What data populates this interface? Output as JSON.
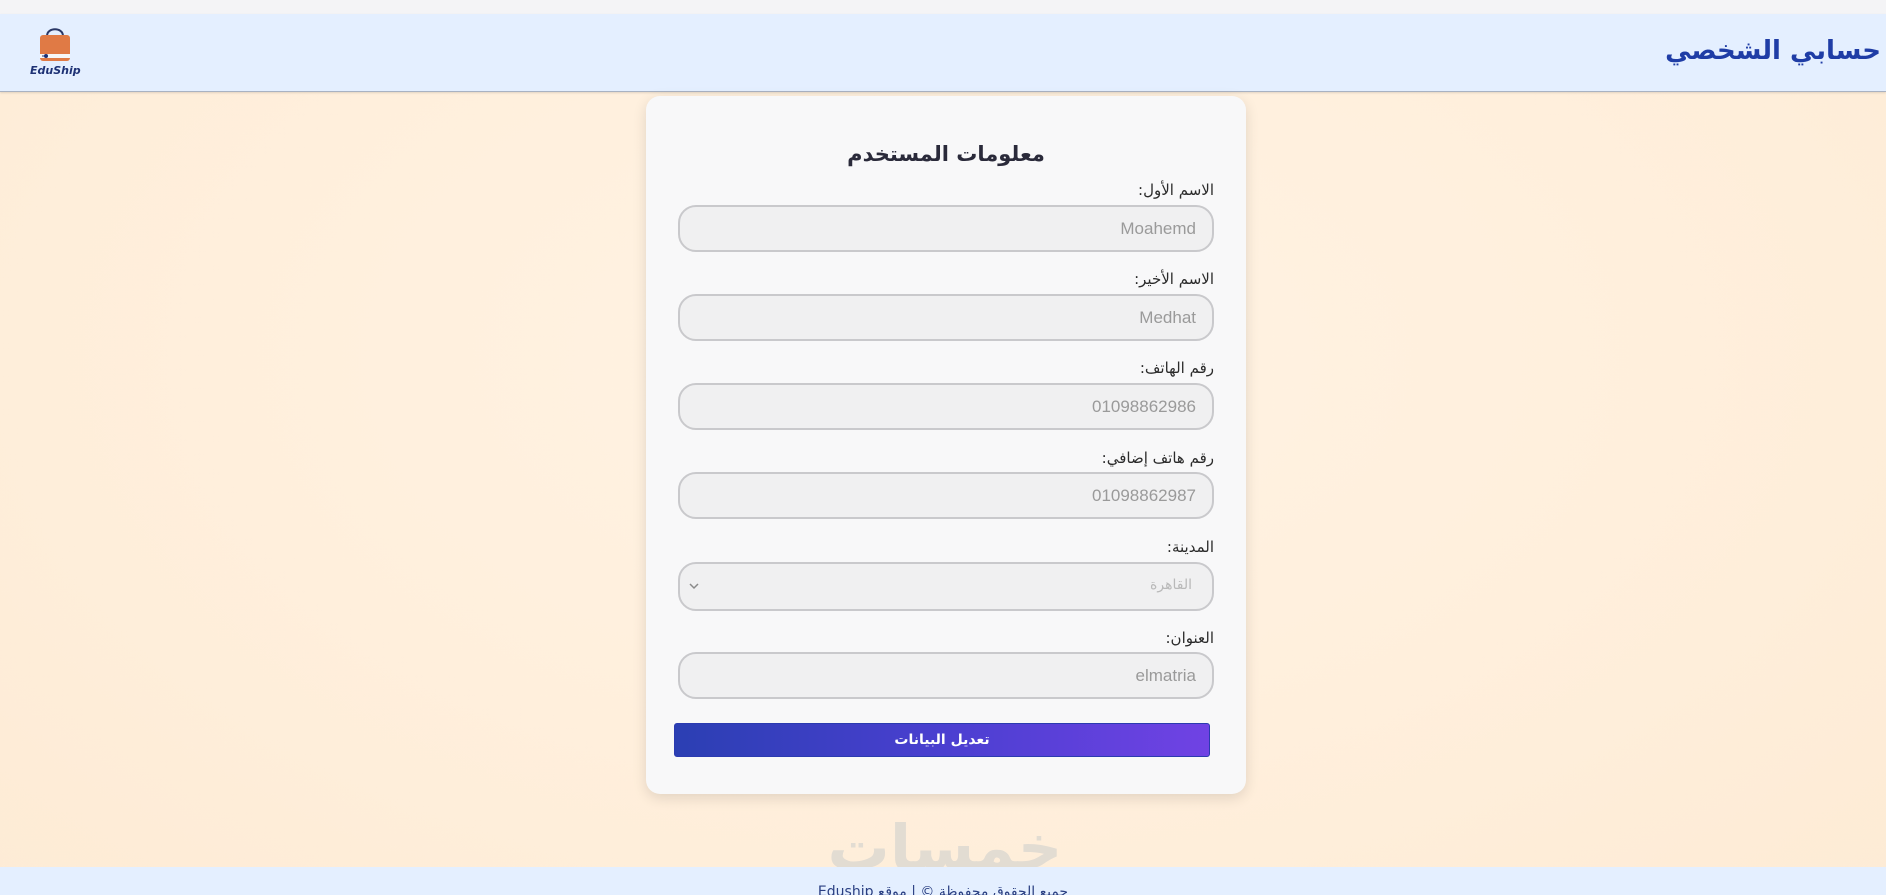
{
  "header": {
    "title": "حسابي الشخصي",
    "logo_text": "EduShip"
  },
  "card": {
    "title": "معلومات المستخدم",
    "fields": [
      {
        "label": "الاسم الأول:",
        "value": "Moahemd"
      },
      {
        "label": "الاسم الأخير:",
        "value": "Medhat"
      },
      {
        "label": "رقم الهاتف:",
        "value": "01098862986"
      },
      {
        "label": "رقم هاتف إضافي:",
        "value": "01098862987"
      }
    ],
    "city": {
      "label": "المدينة:",
      "value": "القاهرة"
    },
    "address": {
      "label": "العنوان:",
      "value": "elmatria"
    },
    "submit_label": "تعديل البيانات"
  },
  "watermark": "خمسات",
  "footer": {
    "text": "جميع الحقوق محفوظة © | موقع Eduship"
  },
  "colors": {
    "header_bg": "#e4efff",
    "title_blue": "#1f3da6",
    "button_start": "#2b3fb3",
    "button_end": "#7042e4",
    "logo_bag": "#e07a45"
  },
  "icons": {
    "logo": "shopping-bag-icon",
    "select": "chevron-down-icon"
  }
}
